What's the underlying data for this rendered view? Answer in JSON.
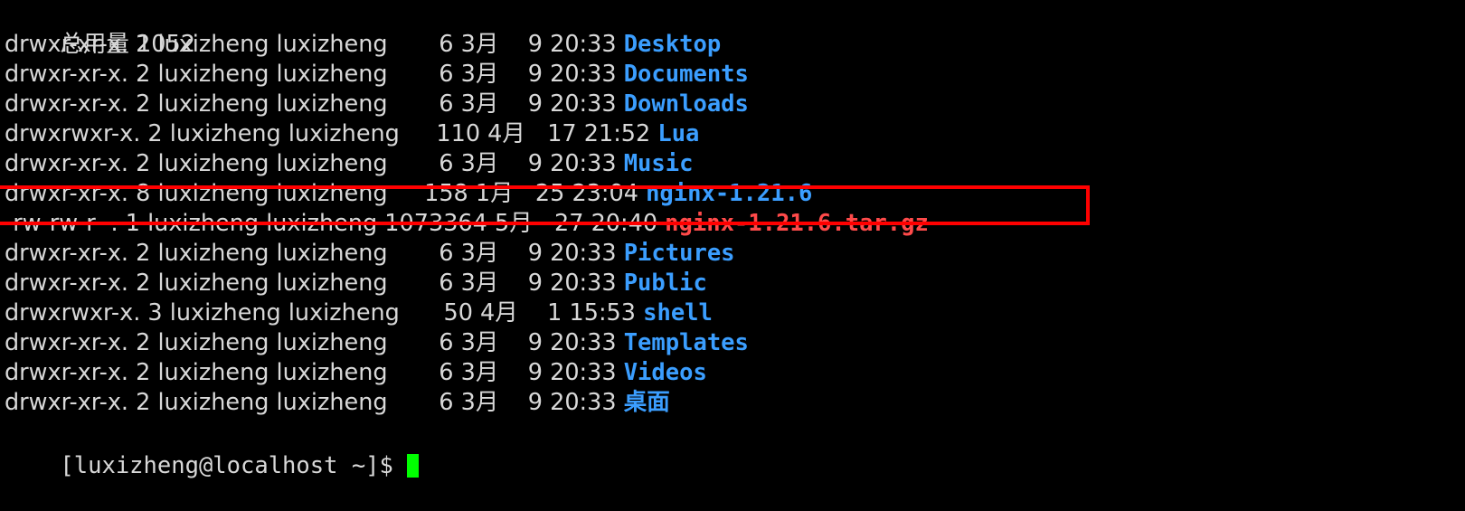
{
  "terminal": {
    "background_color": "#000000",
    "foreground_color": "#d8d8d8",
    "dir_color": "#3b9eff",
    "archive_color": "#ff4a4a",
    "cursor_color": "#00ff00",
    "highlight_color": "#ff0000",
    "total_line": "总用量 1052",
    "prompt": "[luxizheng@localhost ~]$ ",
    "columns_note": "ls -l long listing output"
  },
  "listing": [
    {
      "perms": "drwxr-xr-x.",
      "links": "2",
      "owner": "luxizheng",
      "group": "luxizheng",
      "size": "6",
      "month": "3月",
      "day": "9",
      "time": "20:33",
      "name": "Desktop",
      "type": "dir",
      "prefix": "drwxr-xr-x. 2 luxizheng luxizheng       6 3月    9 20:33 "
    },
    {
      "perms": "drwxr-xr-x.",
      "links": "2",
      "owner": "luxizheng",
      "group": "luxizheng",
      "size": "6",
      "month": "3月",
      "day": "9",
      "time": "20:33",
      "name": "Documents",
      "type": "dir",
      "prefix": "drwxr-xr-x. 2 luxizheng luxizheng       6 3月    9 20:33 "
    },
    {
      "perms": "drwxr-xr-x.",
      "links": "2",
      "owner": "luxizheng",
      "group": "luxizheng",
      "size": "6",
      "month": "3月",
      "day": "9",
      "time": "20:33",
      "name": "Downloads",
      "type": "dir",
      "prefix": "drwxr-xr-x. 2 luxizheng luxizheng       6 3月    9 20:33 "
    },
    {
      "perms": "drwxrwxr-x.",
      "links": "2",
      "owner": "luxizheng",
      "group": "luxizheng",
      "size": "110",
      "month": "4月",
      "day": "17",
      "time": "21:52",
      "name": "Lua",
      "type": "dir",
      "prefix": "drwxrwxr-x. 2 luxizheng luxizheng     110 4月   17 21:52 "
    },
    {
      "perms": "drwxr-xr-x.",
      "links": "2",
      "owner": "luxizheng",
      "group": "luxizheng",
      "size": "6",
      "month": "3月",
      "day": "9",
      "time": "20:33",
      "name": "Music",
      "type": "dir",
      "prefix": "drwxr-xr-x. 2 luxizheng luxizheng       6 3月    9 20:33 "
    },
    {
      "perms": "drwxr-xr-x.",
      "links": "8",
      "owner": "luxizheng",
      "group": "luxizheng",
      "size": "158",
      "month": "1月",
      "day": "25",
      "time": "23:04",
      "name": "nginx-1.21.6",
      "type": "dir",
      "highlighted": true,
      "prefix": "drwxr-xr-x. 8 luxizheng luxizheng     158 1月   25 23:04 "
    },
    {
      "perms": "-rw-rw-r--.",
      "links": "1",
      "owner": "luxizheng",
      "group": "luxizheng",
      "size": "1073364",
      "month": "5月",
      "day": "27",
      "time": "20:40",
      "name": "nginx-1.21.6.tar.gz",
      "type": "archive",
      "prefix": "-rw-rw-r--. 1 luxizheng luxizheng 1073364 5月   27 20:40 "
    },
    {
      "perms": "drwxr-xr-x.",
      "links": "2",
      "owner": "luxizheng",
      "group": "luxizheng",
      "size": "6",
      "month": "3月",
      "day": "9",
      "time": "20:33",
      "name": "Pictures",
      "type": "dir",
      "prefix": "drwxr-xr-x. 2 luxizheng luxizheng       6 3月    9 20:33 "
    },
    {
      "perms": "drwxr-xr-x.",
      "links": "2",
      "owner": "luxizheng",
      "group": "luxizheng",
      "size": "6",
      "month": "3月",
      "day": "9",
      "time": "20:33",
      "name": "Public",
      "type": "dir",
      "prefix": "drwxr-xr-x. 2 luxizheng luxizheng       6 3月    9 20:33 "
    },
    {
      "perms": "drwxrwxr-x.",
      "links": "3",
      "owner": "luxizheng",
      "group": "luxizheng",
      "size": "50",
      "month": "4月",
      "day": "1",
      "time": "15:53",
      "name": "shell",
      "type": "dir",
      "prefix": "drwxrwxr-x. 3 luxizheng luxizheng      50 4月    1 15:53 "
    },
    {
      "perms": "drwxr-xr-x.",
      "links": "2",
      "owner": "luxizheng",
      "group": "luxizheng",
      "size": "6",
      "month": "3月",
      "day": "9",
      "time": "20:33",
      "name": "Templates",
      "type": "dir",
      "prefix": "drwxr-xr-x. 2 luxizheng luxizheng       6 3月    9 20:33 "
    },
    {
      "perms": "drwxr-xr-x.",
      "links": "2",
      "owner": "luxizheng",
      "group": "luxizheng",
      "size": "6",
      "month": "3月",
      "day": "9",
      "time": "20:33",
      "name": "Videos",
      "type": "dir",
      "prefix": "drwxr-xr-x. 2 luxizheng luxizheng       6 3月    9 20:33 "
    },
    {
      "perms": "drwxr-xr-x.",
      "links": "2",
      "owner": "luxizheng",
      "group": "luxizheng",
      "size": "6",
      "month": "3月",
      "day": "9",
      "time": "20:33",
      "name": "桌面",
      "type": "dir-cjk",
      "prefix": "drwxr-xr-x. 2 luxizheng luxizheng       6 3月    9 20:33 "
    }
  ]
}
